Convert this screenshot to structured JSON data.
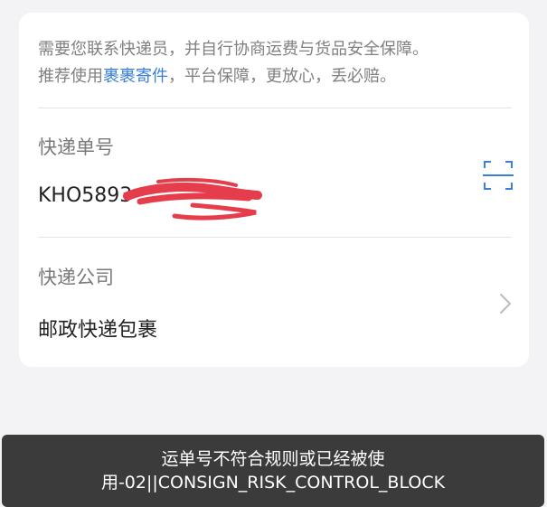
{
  "notice": {
    "line1": "需要您联系快递员，并自行协商运费与货品安全保障。",
    "line2_prefix": "推荐使用",
    "line2_link": "裹裹寄件",
    "line2_suffix": "，平台保障，更放心，丢必赔。"
  },
  "tracking": {
    "label": "快递单号",
    "value_visible": "KHO5893"
  },
  "courier": {
    "label": "快递公司",
    "value": "邮政快递包裹"
  },
  "toast": {
    "line1": "运单号不符合规则或已经被使",
    "line2": "用-02||CONSIGN_RISK_CONTROL_BLOCK"
  },
  "icons": {
    "scan": "scan-icon",
    "chevron": "chevron-right-icon"
  },
  "colors": {
    "link": "#3a7fd8",
    "scan_icon": "#3a7fd8",
    "redaction": "#e53d4b",
    "toast_bg": "#3b3b3b"
  }
}
